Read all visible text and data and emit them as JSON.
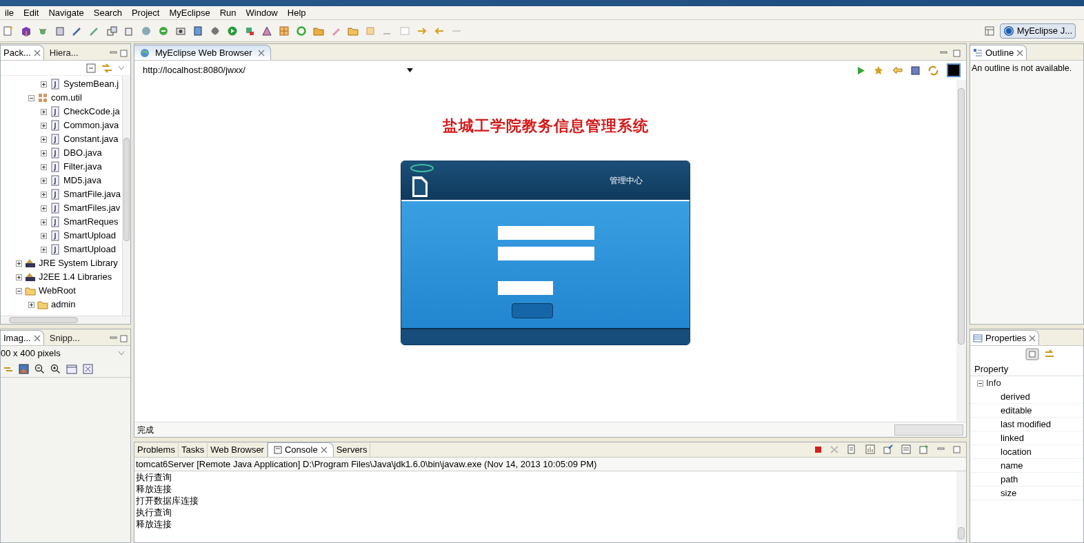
{
  "menu": [
    "ile",
    "Edit",
    "Navigate",
    "Search",
    "Project",
    "MyEclipse",
    "Run",
    "Window",
    "Help"
  ],
  "perspective": {
    "label": "MyEclipse J..."
  },
  "explorer": {
    "tabs": [
      {
        "label": "Pack...",
        "selected": true
      },
      {
        "label": "Hiera...",
        "selected": false
      }
    ],
    "tree": [
      {
        "children": [
          {
            "children": [
              {
                "label": "SystemBean.j",
                "kind": "file",
                "expanded": false
              }
            ]
          },
          {
            "label": "com.util",
            "kind": "package",
            "expanded": true,
            "children": [
              {
                "label": "CheckCode.ja",
                "kind": "file",
                "expanded": false
              },
              {
                "label": "Common.java",
                "kind": "file",
                "expanded": false
              },
              {
                "label": "Constant.java",
                "kind": "file",
                "expanded": false
              },
              {
                "label": "DBO.java",
                "kind": "file",
                "expanded": false
              },
              {
                "label": "Filter.java",
                "kind": "file",
                "expanded": false
              },
              {
                "label": "MD5.java",
                "kind": "file",
                "expanded": false
              },
              {
                "label": "SmartFile.java",
                "kind": "file",
                "expanded": false
              },
              {
                "label": "SmartFiles.jav",
                "kind": "file",
                "expanded": false
              },
              {
                "label": "SmartReques",
                "kind": "file",
                "expanded": false
              },
              {
                "label": "SmartUpload",
                "kind": "file",
                "expanded": false
              },
              {
                "label": "SmartUpload",
                "kind": "file",
                "expanded": false
              }
            ]
          }
        ]
      },
      {
        "label": "JRE System Library",
        "kind": "library",
        "expanded": false
      },
      {
        "label": "J2EE 1.4 Libraries",
        "kind": "library",
        "expanded": false
      },
      {
        "label": "WebRoot",
        "kind": "folder",
        "expanded": true,
        "children": [
          {
            "label": "admin",
            "kind": "folder",
            "expanded": false
          }
        ]
      }
    ]
  },
  "image_view": {
    "tabs": [
      {
        "label": "Imag...",
        "selected": true
      },
      {
        "label": "Snipp...",
        "selected": false
      }
    ],
    "info": "00 x 400 pixels"
  },
  "editor": {
    "tab": "MyEclipse Web Browser",
    "url": "http://localhost:8080/jwxx/",
    "page": {
      "title": "盐城工学院教务信息管理系统",
      "panel_title": "管理中心"
    },
    "status": "完成"
  },
  "console": {
    "tabs": [
      {
        "label": "Problems",
        "selected": false
      },
      {
        "label": "Tasks",
        "selected": false
      },
      {
        "label": "Web Browser",
        "selected": false
      },
      {
        "label": "Console",
        "selected": true
      },
      {
        "label": "Servers",
        "selected": false
      }
    ],
    "process": "tomcat6Server [Remote Java Application] D:\\Program Files\\Java\\jdk1.6.0\\bin\\javaw.exe (Nov 14, 2013 10:05:09 PM)",
    "lines": [
      "执行查询",
      "释放连接",
      "打开数据库连接",
      "执行查询",
      "释放连接"
    ]
  },
  "outline": {
    "tab": "Outline",
    "message": "An outline is not available."
  },
  "properties": {
    "tab": "Properties",
    "column": "Property",
    "group": {
      "label": "Info",
      "expanded": true,
      "items": [
        "derived",
        "editable",
        "last modified",
        "linked",
        "location",
        "name",
        "path",
        "size"
      ]
    }
  }
}
